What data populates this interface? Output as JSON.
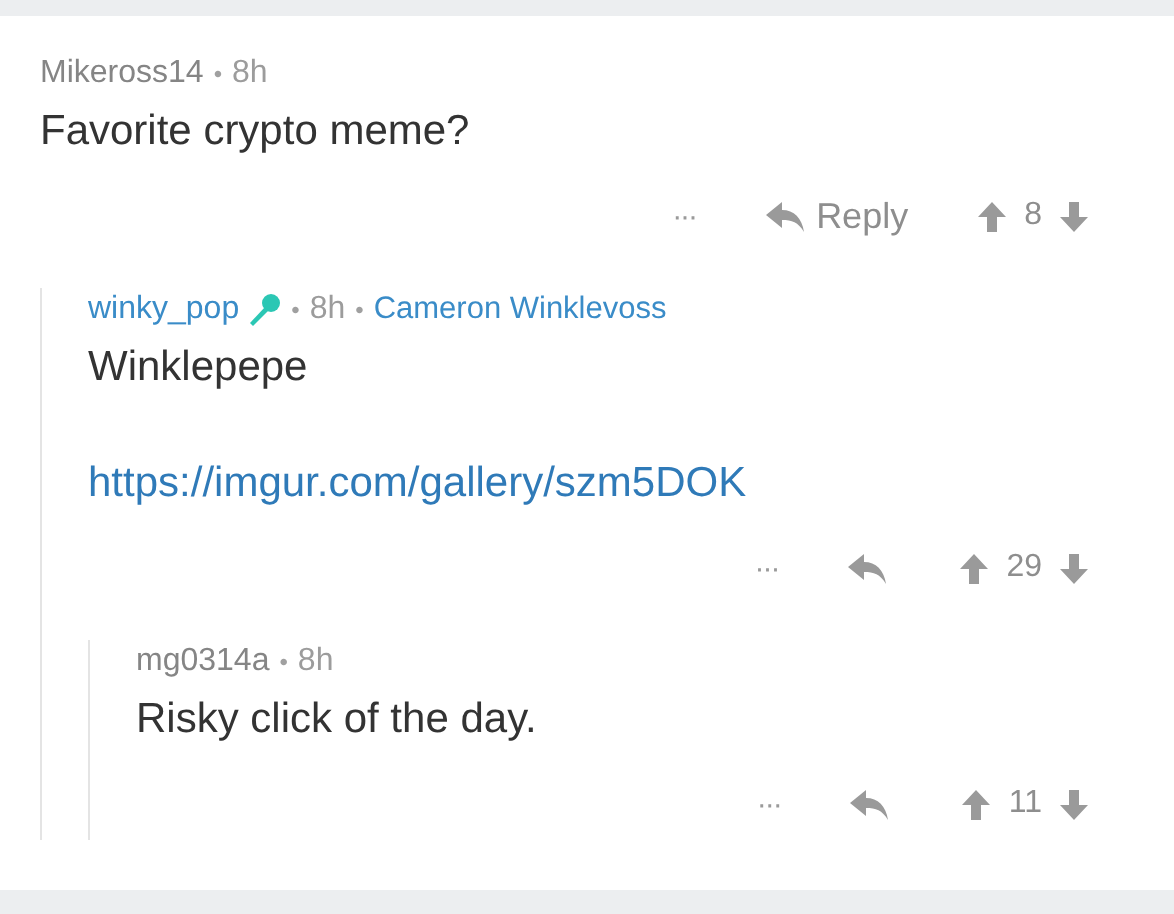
{
  "comment": {
    "meta": [
      {
        "kind": "author",
        "text": "Mikeross14"
      },
      {
        "kind": "sep",
        "text": "•"
      },
      {
        "kind": "time",
        "text": "8h"
      }
    ],
    "body": "Favorite crypto meme?",
    "more": "···",
    "reply_label": "Reply",
    "score": "8",
    "children": [
      {
        "meta": [
          {
            "kind": "link-author",
            "text": "winky_pop"
          },
          {
            "kind": "badge"
          },
          {
            "kind": "sep",
            "text": "•"
          },
          {
            "kind": "time",
            "text": "8h"
          },
          {
            "kind": "sep",
            "text": "•"
          },
          {
            "kind": "flair",
            "text": "Cameron Winklevoss"
          }
        ],
        "body": "Winklepepe",
        "link": "https://imgur.com/gallery/szm5DOK",
        "more": "···",
        "score": "29",
        "children": [
          {
            "meta": [
              {
                "kind": "author",
                "text": "mg0314a"
              },
              {
                "kind": "sep",
                "text": "•"
              },
              {
                "kind": "time",
                "text": "8h"
              }
            ],
            "body": "Risky click of the day.",
            "more": "···",
            "score": "11"
          }
        ]
      }
    ]
  }
}
